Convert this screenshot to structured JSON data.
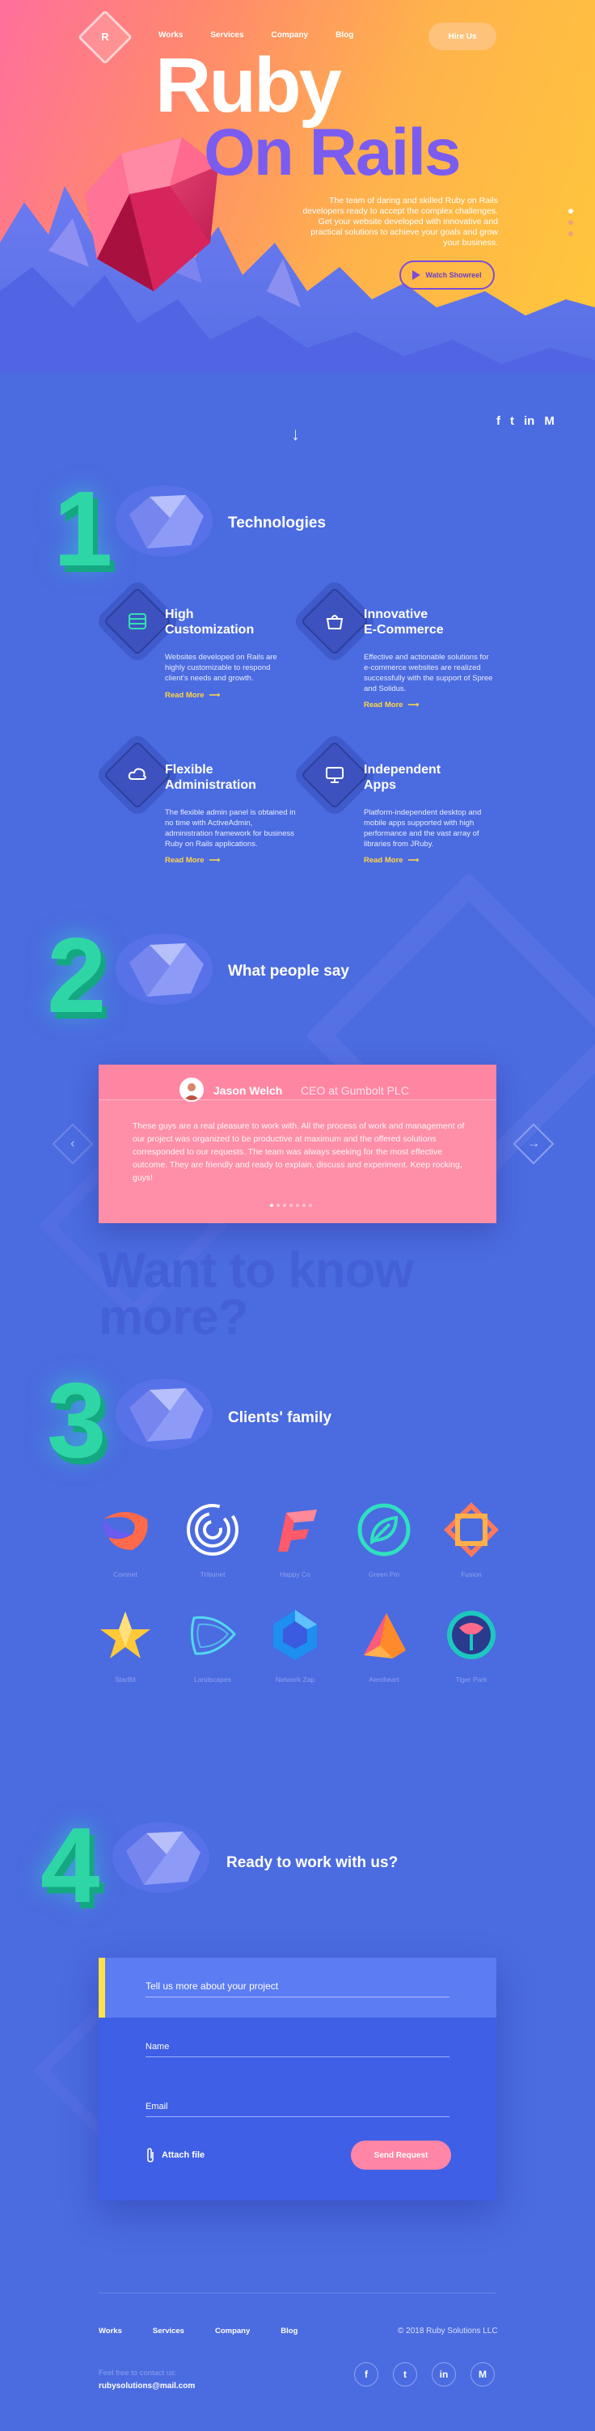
{
  "header": {
    "logo_letter": "R",
    "nav": [
      "Works",
      "Services",
      "Company",
      "Blog"
    ],
    "hire_label": "Hire Us"
  },
  "hero": {
    "title_line1": "Ruby",
    "title_line2": "On Rails",
    "description": "The team of daring and skilled Ruby on Rails developers ready to accept the complex challenges. Get your website developed with innovative and practical solutions to achieve your goals and grow your business.",
    "showreel_label": "Watch Showreel",
    "social": [
      "f",
      "t",
      "in",
      "M"
    ]
  },
  "sections": {
    "s1": {
      "number": "1",
      "title": "Technologies"
    },
    "s2": {
      "number": "2",
      "title": "What people say"
    },
    "s3": {
      "number": "3",
      "title": "Clients' family"
    },
    "s4": {
      "number": "4",
      "title": "Ready to work with us?"
    }
  },
  "features": [
    {
      "title_line1": "High",
      "title_line2": "Customization",
      "desc": "Websites developed on Rails are highly customizable to respond client's needs and growth.",
      "more": "Read More"
    },
    {
      "title_line1": "Innovative",
      "title_line2": "E-Commerce",
      "desc": "Effective and actionable solutions for e-commerce websites are realized successfully with the support of Spree and Solidus.",
      "more": "Read More"
    },
    {
      "title_line1": "Flexible",
      "title_line2": "Administration",
      "desc": "The flexible admin panel is obtained in no time with ActiveAdmin, administration framework for business Ruby on Rails applications.",
      "more": "Read More"
    },
    {
      "title_line1": "Independent",
      "title_line2": "Apps",
      "desc": "Platform-independent desktop and mobile apps supported with high performance and the vast array of libraries from JRuby.",
      "more": "Read More"
    }
  ],
  "testimonial": {
    "name": "Jason Welch",
    "role": "CEO at Gumbolt PLC",
    "text": "These guys are a real pleasure to work with. All the process of work and management of our project was organized to be productive at maximum and the offered solutions corresponded to our requests. The team was always seeking for the most effective outcome. They are friendly and ready to explain, discuss and experiment. Keep rocking, guys!"
  },
  "want_to_know": {
    "line1": "Want to know",
    "line2": "more?"
  },
  "clients": [
    {
      "name": "Comnet",
      "icon": "comnet-logo"
    },
    {
      "name": "Tribunet",
      "icon": "tribunet-logo"
    },
    {
      "name": "Happy Co",
      "icon": "happy-co-logo"
    },
    {
      "name": "Green Pin",
      "icon": "green-pin-logo"
    },
    {
      "name": "Fusion",
      "icon": "fusion-logo"
    },
    {
      "name": "StarBit",
      "icon": "starbit-logo"
    },
    {
      "name": "Landscapes",
      "icon": "landscapes-logo"
    },
    {
      "name": "Network Zap",
      "icon": "network-zap-logo"
    },
    {
      "name": "Aeroheart",
      "icon": "aeroheart-logo"
    },
    {
      "name": "Tiger Park",
      "icon": "tiger-park-logo"
    }
  ],
  "form": {
    "prompt": "Tell us more about your project",
    "name_label": "Name",
    "email_label": "Email",
    "attach_label": "Attach file",
    "send_label": "Send Request"
  },
  "footer": {
    "nav": [
      "Works",
      "Services",
      "Company",
      "Blog"
    ],
    "copyright": "© 2018 Ruby Solutions LLC",
    "contact_label": "Feel free to contact us:",
    "email": "rubysolutions@mail.com",
    "social": [
      "f",
      "t",
      "in",
      "M"
    ]
  },
  "colors": {
    "accent_green": "#2fd6a5",
    "accent_yellow": "#ffd646",
    "accent_pink": "#ff86a6",
    "background": "#4b6be0"
  }
}
